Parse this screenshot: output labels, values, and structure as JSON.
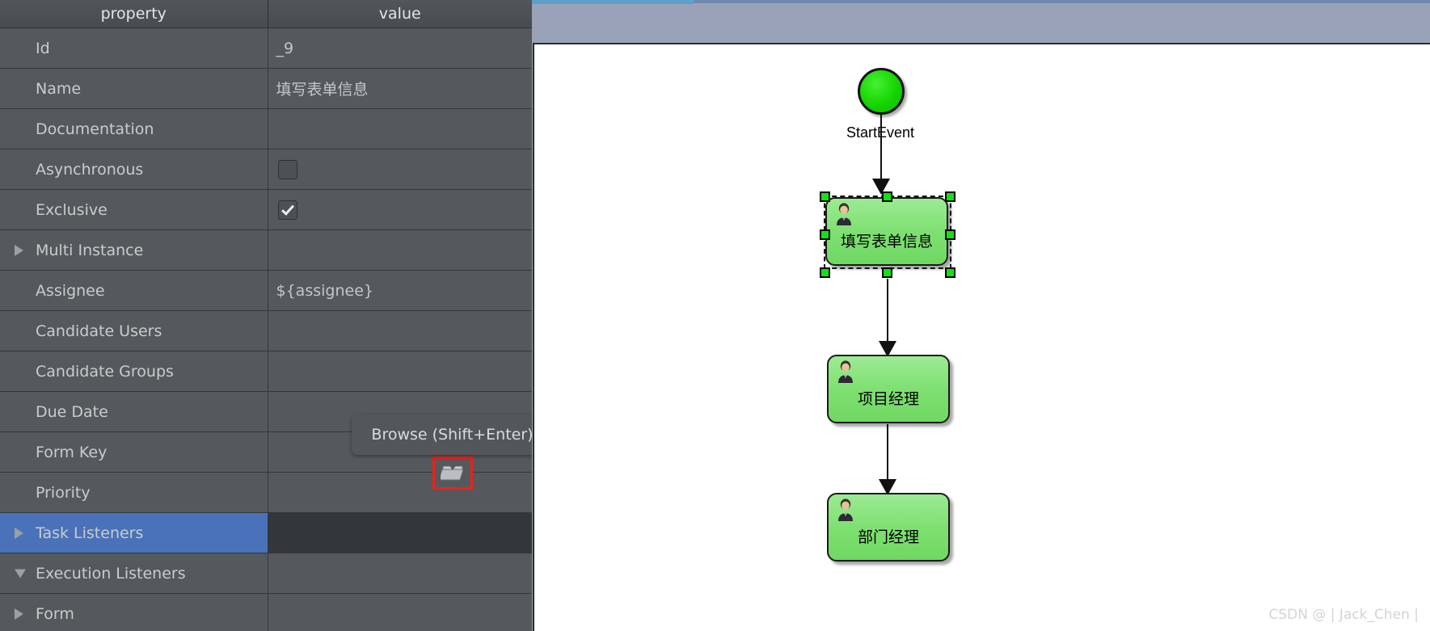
{
  "properties_panel": {
    "columns": [
      "property",
      "value"
    ],
    "rows": [
      {
        "twisty": "none",
        "label": "Id",
        "value": "_9",
        "type": "text",
        "selected": false
      },
      {
        "twisty": "none",
        "label": "Name",
        "value": "填写表单信息",
        "type": "text",
        "selected": false
      },
      {
        "twisty": "none",
        "label": "Documentation",
        "value": "",
        "type": "text",
        "selected": false
      },
      {
        "twisty": "none",
        "label": "Asynchronous",
        "value": "",
        "type": "checkbox",
        "checked": false,
        "selected": false
      },
      {
        "twisty": "none",
        "label": "Exclusive",
        "value": "",
        "type": "checkbox",
        "checked": true,
        "selected": false
      },
      {
        "twisty": "right",
        "label": "Multi Instance",
        "value": "",
        "type": "text",
        "selected": false
      },
      {
        "twisty": "none",
        "label": "Assignee",
        "value": "${assignee}",
        "type": "text",
        "selected": false
      },
      {
        "twisty": "none",
        "label": "Candidate Users",
        "value": "",
        "type": "text",
        "selected": false
      },
      {
        "twisty": "none",
        "label": "Candidate Groups",
        "value": "",
        "type": "text",
        "selected": false
      },
      {
        "twisty": "none",
        "label": "Due Date",
        "value": "",
        "type": "text",
        "selected": false
      },
      {
        "twisty": "none",
        "label": "Form Key",
        "value": "",
        "type": "text",
        "selected": false
      },
      {
        "twisty": "none",
        "label": "Priority",
        "value": "",
        "type": "text",
        "selected": false
      },
      {
        "twisty": "right",
        "label": "Task Listeners",
        "value": "",
        "type": "text",
        "selected": true
      },
      {
        "twisty": "down",
        "label": "Execution Listeners",
        "value": "",
        "type": "text",
        "selected": false
      },
      {
        "twisty": "right",
        "label": "Form",
        "value": "",
        "type": "text",
        "selected": false
      }
    ]
  },
  "tooltip": {
    "text": "Browse (Shift+Enter)"
  },
  "browse_button": {
    "icon": "folder-open-icon",
    "highlight_color": "#f01f16"
  },
  "diagram": {
    "start_event": {
      "label": "StartEvent"
    },
    "tasks": [
      {
        "label": "填写表单信息",
        "icon": "user-task-icon",
        "selected": true
      },
      {
        "label": "项目经理",
        "icon": "user-task-icon",
        "selected": false
      },
      {
        "label": "部门经理",
        "icon": "user-task-icon",
        "selected": false
      }
    ]
  },
  "watermark": {
    "text": "CSDN @ | Jack_Chen |"
  },
  "colors": {
    "panel_bg": "#55595c",
    "header_bg": "#4a4f53",
    "selection_blue": "#4a72b8",
    "node_green": "#7fe072",
    "start_green": "#15d400",
    "canvas_surround": "#9aa2b8"
  }
}
